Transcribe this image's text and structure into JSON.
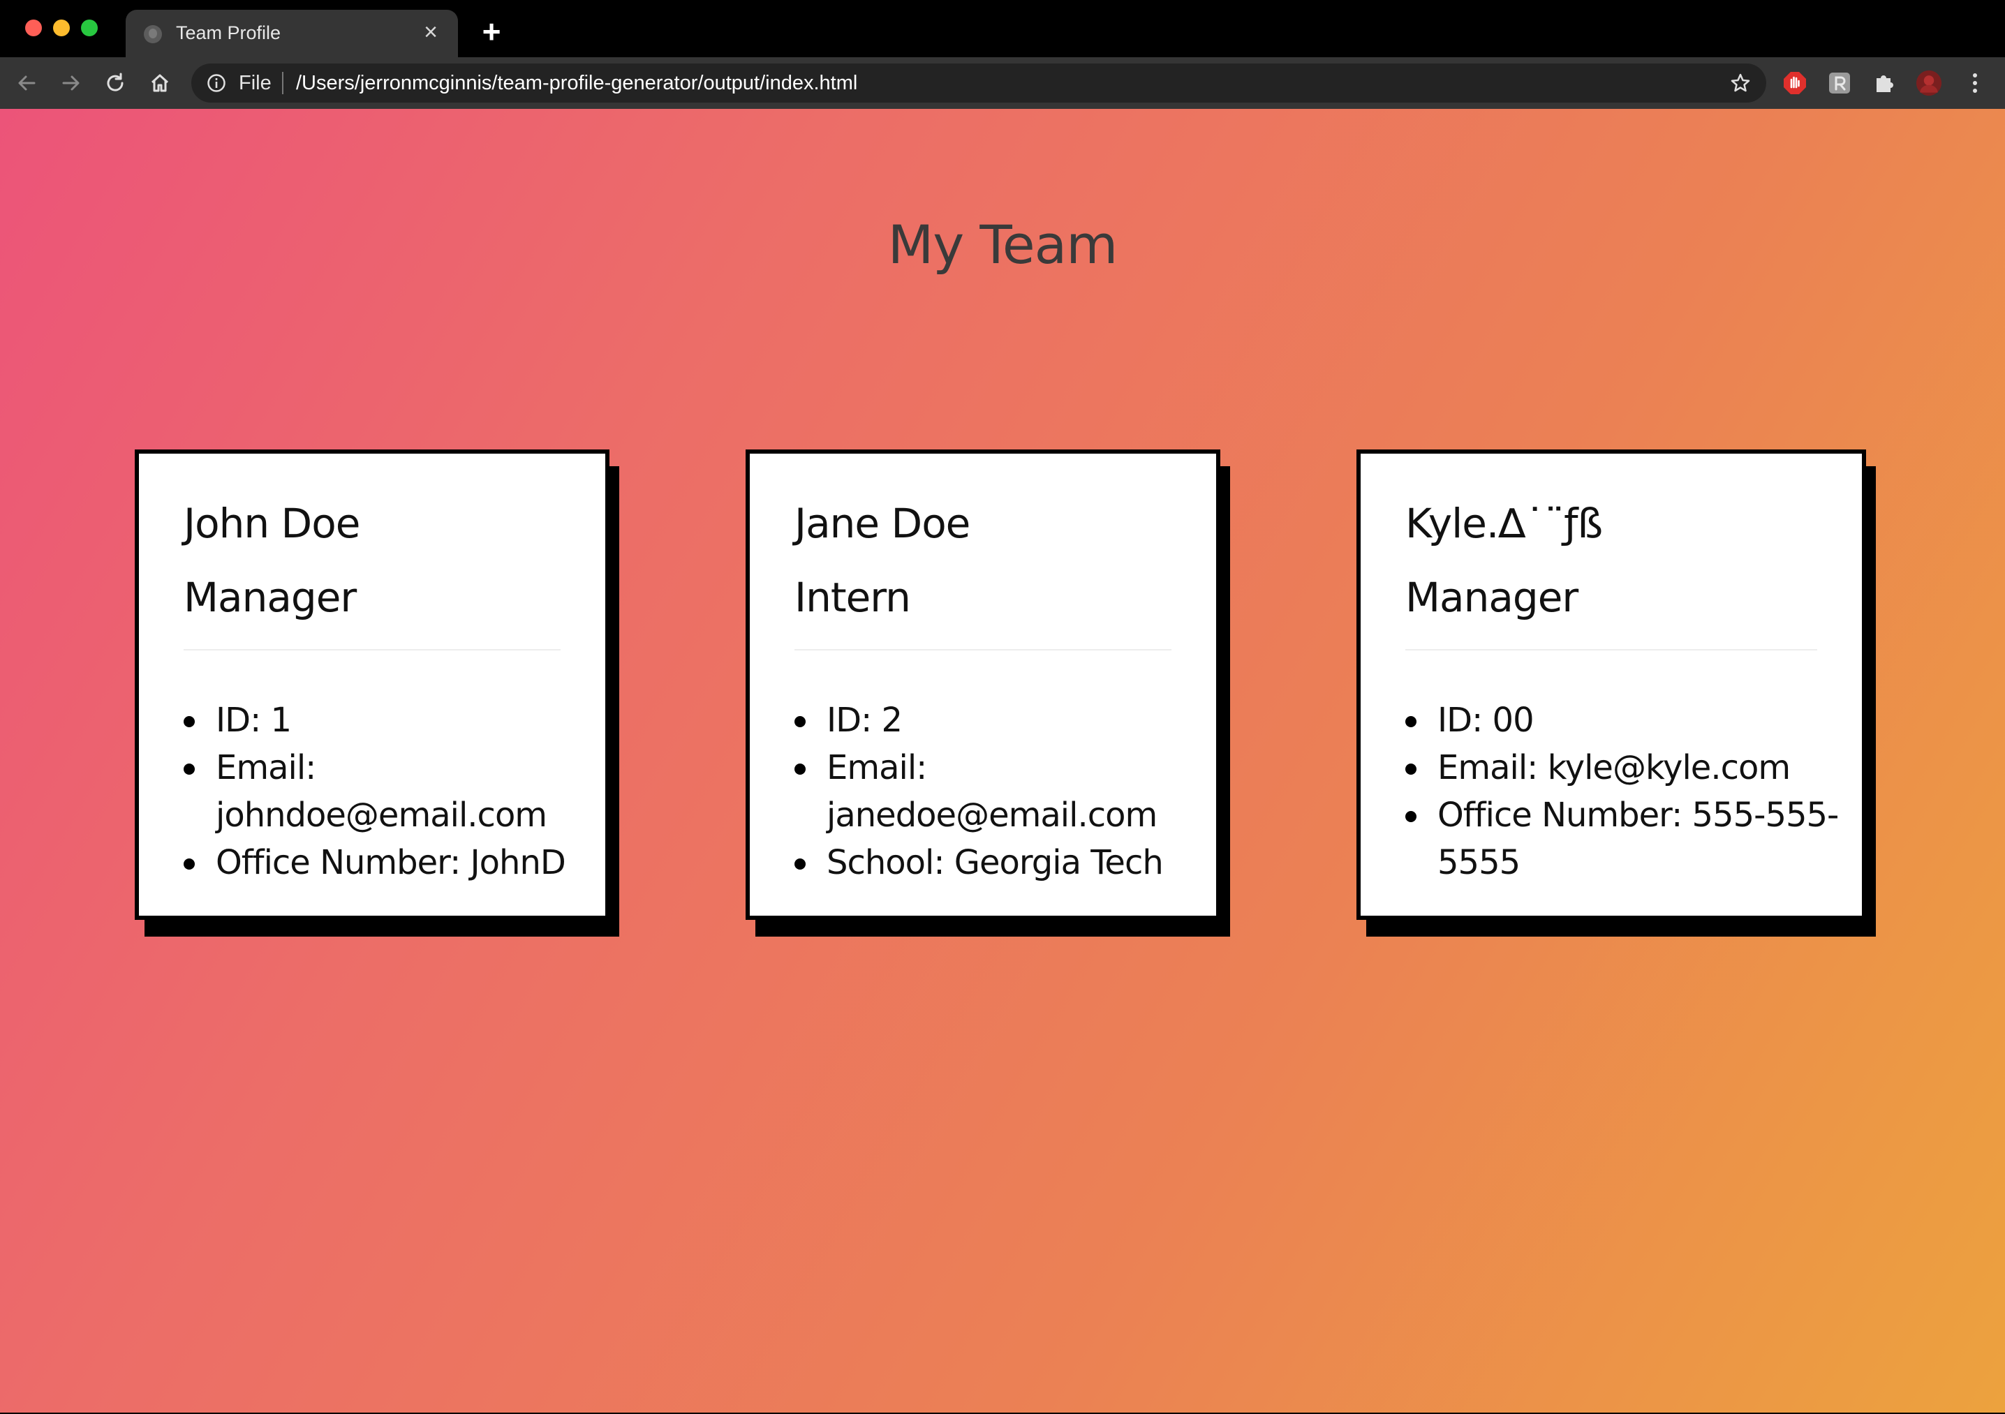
{
  "browser": {
    "tab_title": "Team Profile",
    "close_glyph": "×",
    "new_tab_glyph": "+",
    "scheme_label": "File",
    "url": "/Users/jerronmcginnis/team-profile-generator/output/index.html",
    "colors": {
      "chrome_bg": "#000000",
      "toolbar_bg": "#353535",
      "omnibox_bg": "#232323",
      "traffic_red": "#fe5f57",
      "traffic_yellow": "#febc2e",
      "traffic_green": "#28c840"
    },
    "icons": [
      "back-arrow-icon",
      "forward-arrow-icon",
      "reload-icon",
      "home-icon",
      "info-icon",
      "bookmark-star-icon",
      "adblock-extension-icon",
      "extension-r-icon",
      "extensions-puzzle-icon",
      "profile-avatar",
      "kebab-menu-icon"
    ]
  },
  "page": {
    "heading": "My Team",
    "gradient": [
      "#ec5479",
      "#eca23e"
    ],
    "cards": [
      {
        "name": "John Doe",
        "role": "Manager",
        "details": [
          "ID: 1",
          "Email: johndoe@email.com",
          "Office Number: JohnD"
        ]
      },
      {
        "name": "Jane Doe",
        "role": "Intern",
        "details": [
          "ID: 2",
          "Email: janedoe@email.com",
          "School: Georgia Tech"
        ]
      },
      {
        "name": "Kyle.∆˙¨ƒß",
        "role": "Manager",
        "details": [
          "ID: 00",
          "Email: kyle@kyle.com",
          "Office Number: 555-555-5555"
        ]
      }
    ]
  }
}
